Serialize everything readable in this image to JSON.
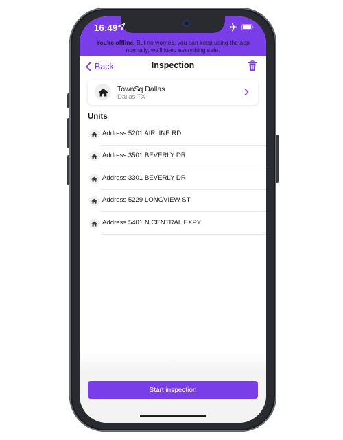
{
  "status_bar": {
    "time": "16:49",
    "icons": [
      "location-arrow-icon",
      "airplane-mode-icon",
      "battery-icon"
    ]
  },
  "offline_banner": {
    "bold": "You're offline.",
    "line1_rest": " But no worries, you can keep using the app",
    "line2": "normally, we'll keep everything safe."
  },
  "nav": {
    "back_label": "Back",
    "title": "Inspection",
    "trash_icon": "trash-icon"
  },
  "property": {
    "name": "TownSq Dallas",
    "location": "Dallas TX",
    "icon": "house-icon"
  },
  "units": {
    "heading": "Units",
    "items": [
      {
        "label": "Address 5201 AIRLINE RD"
      },
      {
        "label": "Address 3501 BEVERLY DR"
      },
      {
        "label": "Address 3301 BEVERLY DR"
      },
      {
        "label": "Address 5229 LONGVIEW ST"
      },
      {
        "label": "Address 5401 N CENTRAL EXPY"
      }
    ]
  },
  "footer": {
    "start_label": "Start inspection"
  },
  "colors": {
    "accent": "#7a3ee8",
    "text": "#1c1c1e",
    "muted": "#8e8e93"
  }
}
